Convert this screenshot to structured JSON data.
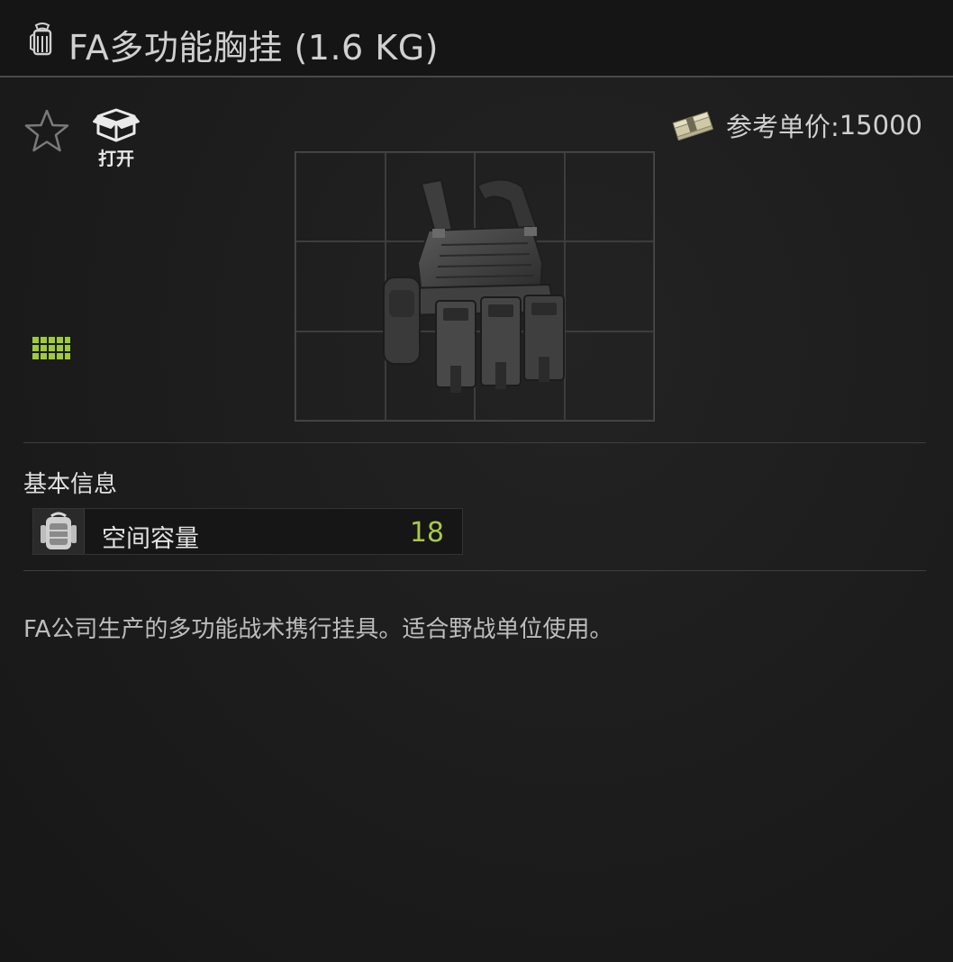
{
  "header": {
    "title": "FA多功能胸挂 (1.6 KG)",
    "icon": "backpack-icon"
  },
  "actions": {
    "favorite_icon": "star-icon",
    "open_label": "打开",
    "open_icon": "box-open-icon"
  },
  "price": {
    "icon": "money-stack-icon",
    "label": "参考单价:",
    "value": "15000"
  },
  "item": {
    "image": "tactical-vest-image",
    "grid_icon": "grid-size-icon",
    "grid_color": "#9ecb3c"
  },
  "basic_info": {
    "section_title": "基本信息",
    "stats": [
      {
        "icon": "backpack-capacity-icon",
        "label": "空间容量",
        "value": "18",
        "value_color": "#a8c84a"
      }
    ]
  },
  "description": "FA公司生产的多功能战术携行挂具。适合野战单位使用。"
}
